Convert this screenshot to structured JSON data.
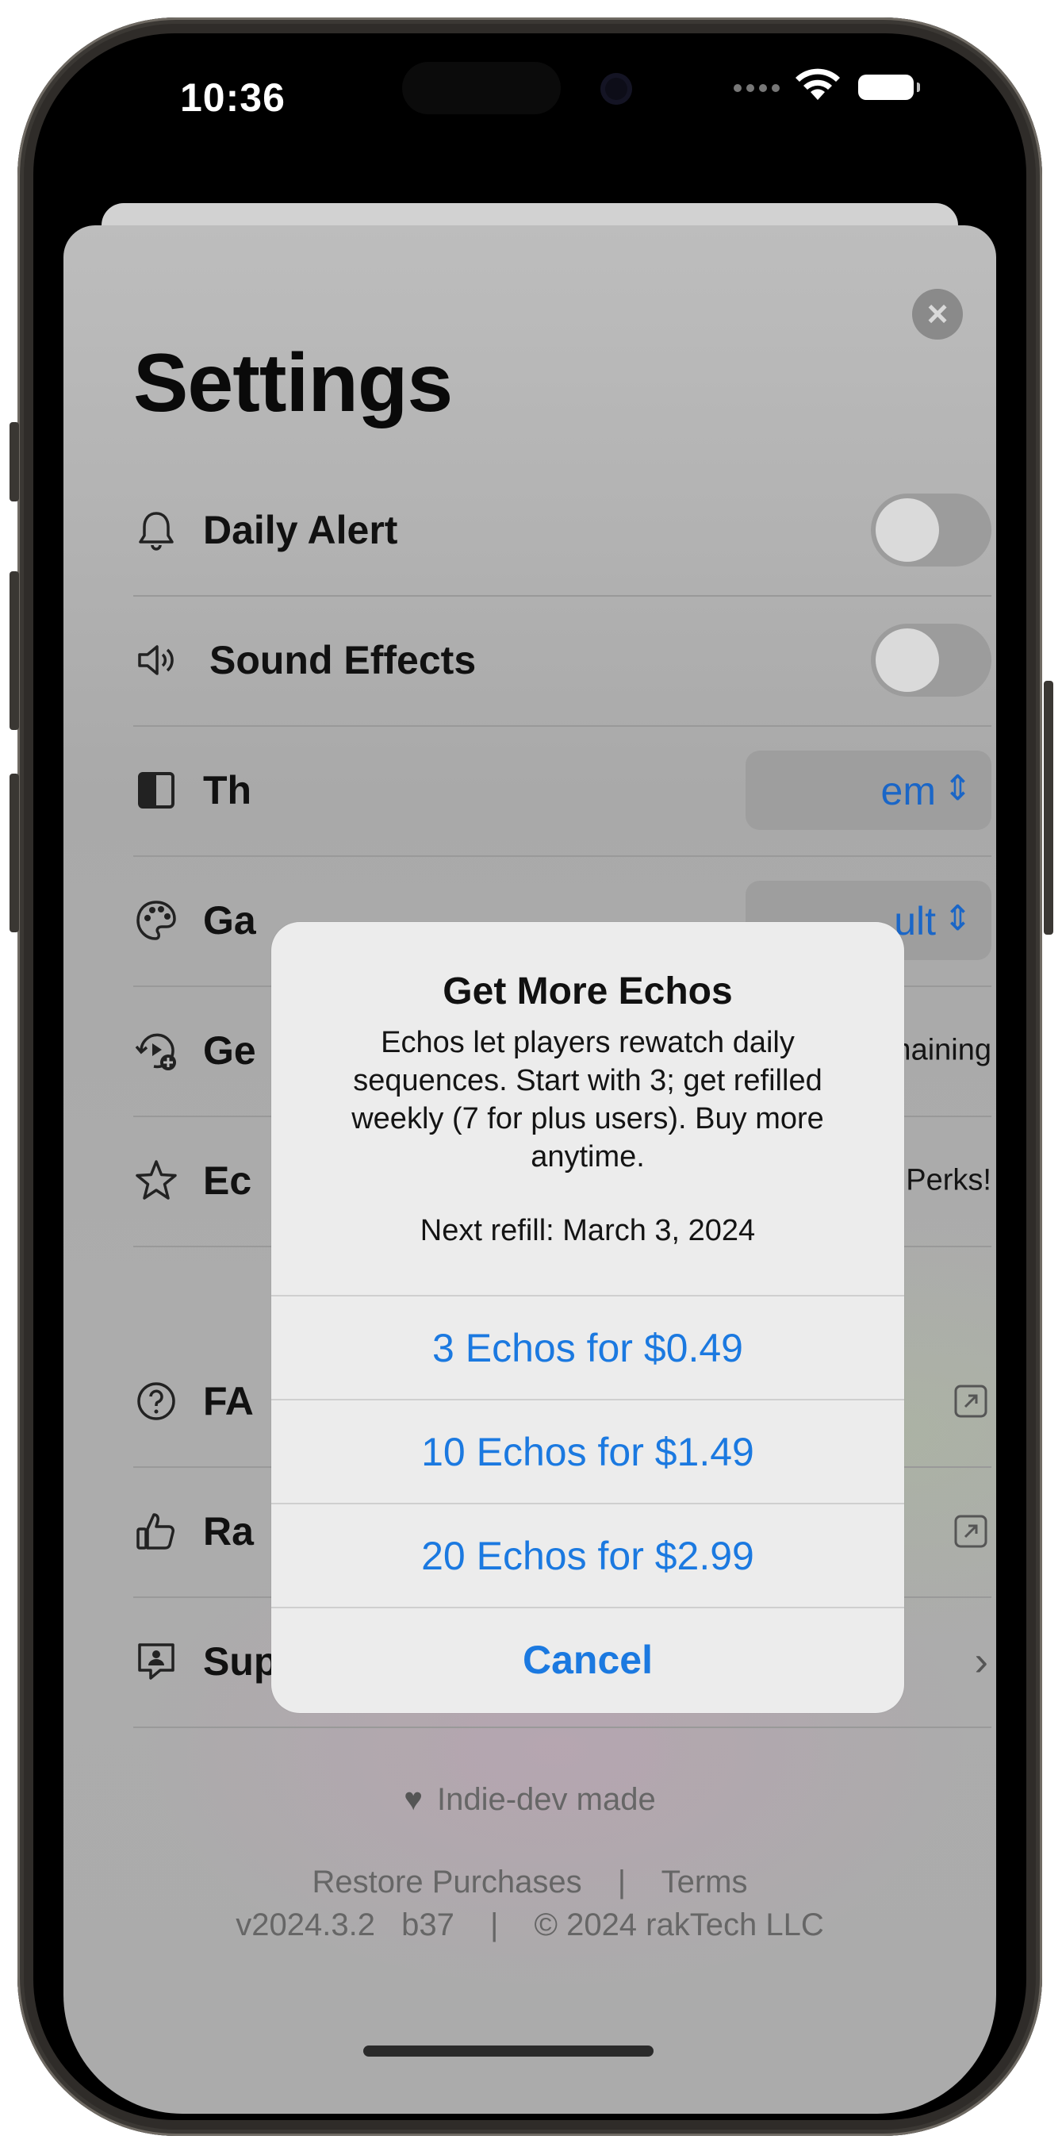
{
  "status_bar": {
    "time": "10:36"
  },
  "settings": {
    "title": "Settings",
    "close_icon": "×",
    "rows": {
      "daily_alert": {
        "label": "Daily Alert",
        "icon": "bell-icon",
        "toggle_on": false
      },
      "sound_effects": {
        "label": "Sound Effects",
        "icon": "speaker-icon",
        "toggle_on": false
      },
      "theme": {
        "label": "Th",
        "icon": "theme-icon",
        "value": "em",
        "chevron": "⌃⌄"
      },
      "game": {
        "label": "Ga",
        "icon": "palette-icon",
        "value": "ult",
        "chevron": "⌃⌄"
      },
      "get_echos": {
        "label": "Ge",
        "icon": "replay-plus-icon",
        "trailing": "maining"
      },
      "echo_plus": {
        "label": "Ec",
        "icon": "star-icon",
        "trailing": "Perks!"
      },
      "faq": {
        "label": "FA",
        "icon": "question-icon"
      },
      "rate": {
        "label": "Ra",
        "icon": "thumbs-up-icon"
      },
      "support": {
        "label": "Support",
        "icon": "support-icon",
        "chevron": "›"
      }
    },
    "footer": {
      "heart_text": "Indie-dev made",
      "restore_label": "Restore Purchases",
      "separator": "|",
      "terms_label": "Terms",
      "version": "v2024.3.2",
      "build": "b37",
      "copyright": "© 2024 rakTech LLC"
    }
  },
  "alert": {
    "title": "Get More Echos",
    "message": "Echos let players rewatch daily sequences. Start with 3; get refilled weekly (7 for plus users). Buy more anytime.",
    "refill": "Next refill: March 3, 2024",
    "options": [
      "3 Echos for $0.49",
      "10 Echos for $1.49",
      "20 Echos for $2.99"
    ],
    "cancel": "Cancel"
  },
  "colors": {
    "accent": "#1b79e0",
    "overlay_bg": "#ababab"
  }
}
